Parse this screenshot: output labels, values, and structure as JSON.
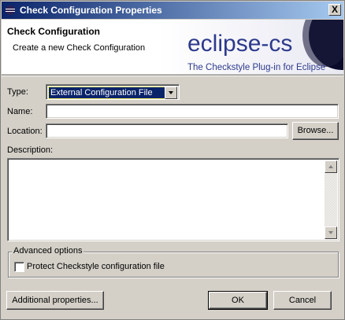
{
  "window": {
    "title": "Check Configuration Properties",
    "close_glyph": "X"
  },
  "banner": {
    "title": "Check Configuration",
    "subtitle": "Create a new Check Configuration",
    "logo_text": "eclipse-cs",
    "logo_subtitle": "The Checkstyle Plug-in for Eclipse"
  },
  "form": {
    "type_label": "Type:",
    "type_value": "External Configuration File",
    "name_label": "Name:",
    "name_value": "",
    "location_label": "Location:",
    "location_value": "",
    "browse_label": "Browse...",
    "description_label": "Description:",
    "description_value": ""
  },
  "advanced": {
    "title": "Advanced options",
    "protect_label": "Protect Checkstyle configuration file",
    "protect_checked": false
  },
  "footer": {
    "additional_label": "Additional properties...",
    "ok_label": "OK",
    "cancel_label": "Cancel"
  },
  "colors": {
    "titlebar_start": "#0a246a",
    "titlebar_end": "#a6caf0",
    "logo_blue": "#2d3a8c",
    "dialog_bg": "#d4d0c8",
    "selection": "#0a246a"
  },
  "icons": {
    "window_icon": "eclipse-icon",
    "close_icon": "close-icon",
    "combo_arrow": "chevron-down-icon",
    "scroll_up": "arrow-up-icon",
    "scroll_down": "arrow-down-icon"
  }
}
